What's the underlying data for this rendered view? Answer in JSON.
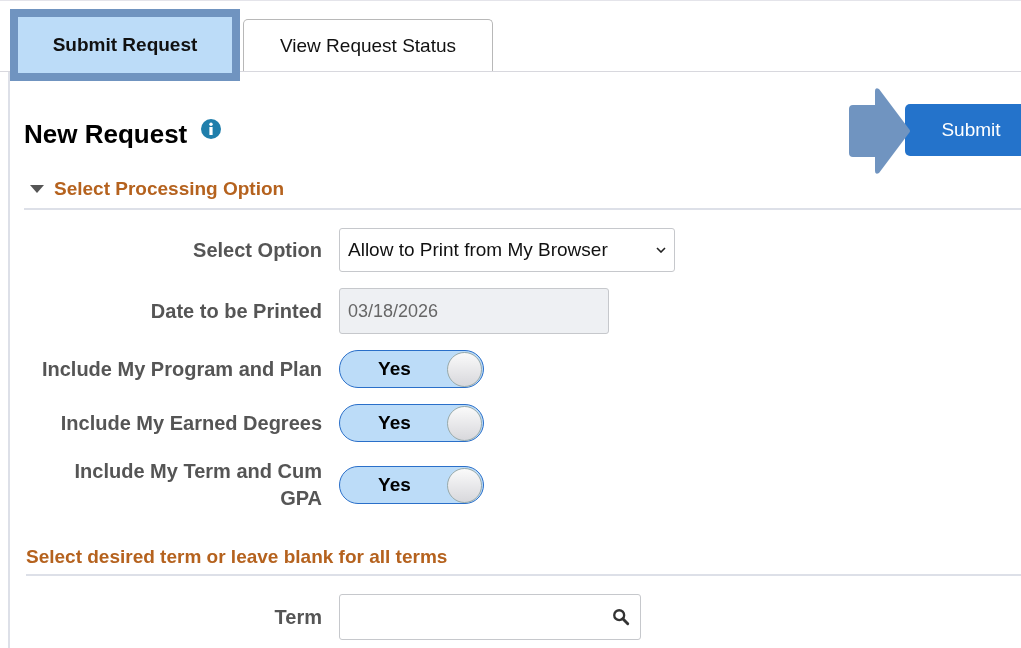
{
  "tabs": [
    {
      "label": "Submit Request",
      "selected": true
    },
    {
      "label": "View Request Status",
      "selected": false
    }
  ],
  "header": {
    "title": "New Request",
    "submit_button": "Submit"
  },
  "processing_section": {
    "title": "Select Processing Option",
    "expanded": true,
    "fields": [
      {
        "kind": "select",
        "label": "Select Option",
        "value": "Allow to Print from My Browser"
      },
      {
        "kind": "date",
        "label": "Date to be Printed",
        "value": "03/18/2026",
        "disabled": true
      },
      {
        "kind": "toggle",
        "label": "Include My Program and Plan",
        "on": true,
        "text": "Yes"
      },
      {
        "kind": "toggle",
        "label": "Include My Earned Degrees",
        "on": true,
        "text": "Yes"
      },
      {
        "kind": "toggle",
        "label": "Include My Term and Cum GPA",
        "on": true,
        "text": "Yes"
      }
    ]
  },
  "term_section": {
    "title": "Select desired term or leave blank for all terms",
    "fields": [
      {
        "kind": "lookup",
        "label": "Term"
      }
    ]
  }
}
